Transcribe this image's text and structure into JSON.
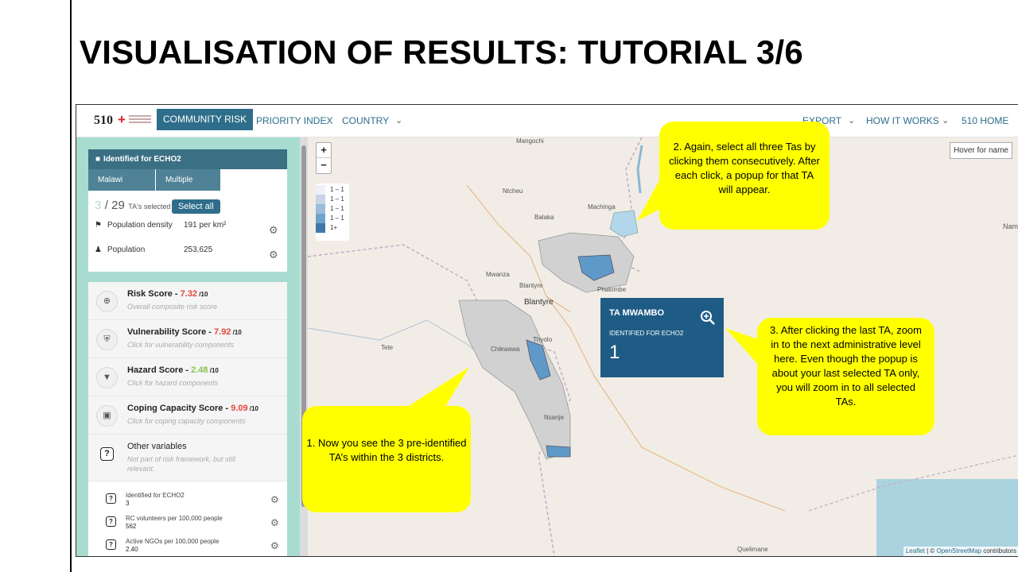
{
  "slide": {
    "title": "VISUALISATION OF RESULTS: TUTORIAL 3/6"
  },
  "nav": {
    "logo_text": "510",
    "items": [
      "COMMUNITY RISK",
      "PRIORITY INDEX",
      "COUNTRY",
      "EXPORT",
      "HOW IT WORKS",
      "510 HOME"
    ],
    "chevron": "⌄"
  },
  "sidebar": {
    "header_title": "Identified for ECHO2",
    "tabs": [
      "Malawi",
      "Multiple Districts"
    ],
    "selected_count": "3",
    "selected_total": "/ 29",
    "selected_label": "TA's selected",
    "select_all_label": "Select all",
    "stats": [
      {
        "label": "Population density",
        "value": "191 per km²"
      },
      {
        "label": "Population",
        "value": "253,625"
      }
    ],
    "components": [
      {
        "title": "Risk Score - ",
        "value": "7.32",
        "denom": " /10",
        "subtitle": "Overall composite risk score"
      },
      {
        "title": "Vulnerability Score - ",
        "value": "7.92",
        "denom": " /10",
        "subtitle": "Click for vulnerability components"
      },
      {
        "title": "Hazard Score - ",
        "value": "2.48",
        "denom": " /10",
        "subtitle": "Click for hazard components"
      },
      {
        "title": "Coping Capacity Score - ",
        "value": "9.09",
        "denom": " /10",
        "subtitle": "Click for coping capacity components"
      },
      {
        "title": "Other variables",
        "value": "",
        "denom": "",
        "subtitle": "Not part of risk framework, but still relevant."
      }
    ],
    "variables": [
      {
        "name": "Identified for ECHO2",
        "value": "3"
      },
      {
        "name": "RC volunteers per 100,000 people",
        "value": "562"
      },
      {
        "name": "Active NGOs per 100,000 people",
        "value": "2.40"
      }
    ]
  },
  "map": {
    "zoom_in": "+",
    "zoom_out": "−",
    "legend": [
      {
        "label": "1 – 1",
        "color": "#eef1f8"
      },
      {
        "label": "1 – 1",
        "color": "#c6d4e8"
      },
      {
        "label": "1 – 1",
        "color": "#9cbcdc"
      },
      {
        "label": "1 – 1",
        "color": "#6fa3cd"
      },
      {
        "label": "1+",
        "color": "#3f78a8"
      }
    ],
    "hover_label": "Hover for name",
    "places": [
      "Mangochi",
      "Ntcheu",
      "Machinga",
      "Balaka",
      "Mwanza",
      "Blantyre",
      "Blantyre",
      "Phalombe",
      "Tete",
      "Thyolo",
      "Chikwawa",
      "Nsanje",
      "Quelimane",
      "Nam"
    ],
    "attribution_leaflet": "Leaflet",
    "attribution_rest": " | © ",
    "attribution_osm": "OpenStreetMap",
    "attribution_tail": " contributors",
    "popup": {
      "title": "TA MWAMBO",
      "subtitle": "IDENTIFIED FOR ECHO2",
      "value": "1"
    }
  },
  "callouts": {
    "one": "1. Now you see the 3 pre-identified TA’s within the 3 districts.",
    "two": "2. Again, select all three Tas by clicking them consecutively. After each click, a popup  for that TA will appear.",
    "three": "3. After clicking the last TA, zoom in to the next administrative level here. Even though the popup is about your last selected TA only, you will zoom in to all selected TAs."
  }
}
